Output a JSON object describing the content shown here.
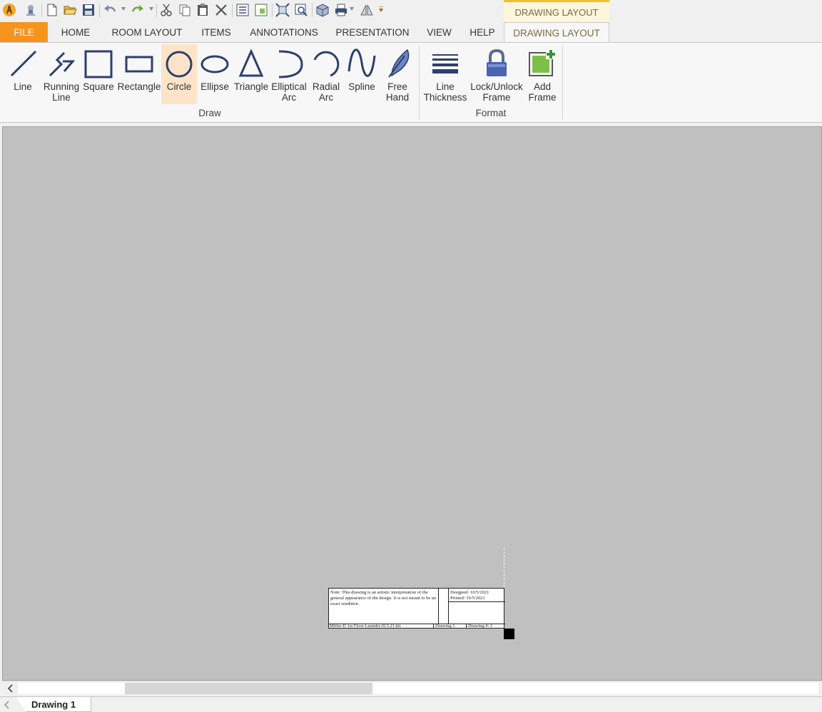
{
  "contextual_header": "DRAWING LAYOUT",
  "tabs": {
    "file": "FILE",
    "home": "HOME",
    "room_layout": "ROOM LAYOUT",
    "items": "ITEMS",
    "annotations": "ANNOTATIONS",
    "presentation": "PRESENTATION",
    "view": "VIEW",
    "help": "HELP",
    "drawing_layout": "DRAWING LAYOUT"
  },
  "ribbon": {
    "draw": {
      "label": "Draw",
      "buttons": {
        "line": "Line",
        "running_line": "Running\nLine",
        "square": "Square",
        "rectangle": "Rectangle",
        "circle": "Circle",
        "ellipse": "Ellipse",
        "triangle": "Triangle",
        "elliptical_arc": "Elliptical\nArc",
        "radial_arc": "Radial\nArc",
        "spline": "Spline",
        "free_hand": "Free\nHand"
      },
      "selected": "circle"
    },
    "format": {
      "label": "Format",
      "buttons": {
        "line_thickness": "Line\nThickness",
        "lock_unlock": "Lock/Unlock\nFrame",
        "add_frame": "Add\nFrame"
      }
    }
  },
  "title_block": {
    "note": "Note: This drawing is an artistic interpretation of the general appearance of the design. It is not meant to be an exact rendition.",
    "designed": "Designed: 10/5/2021",
    "printed": "Printed: 10/5/2021",
    "file": "Miller-D 1st Floor Laundry10.5.21.kit",
    "drawing": "Drawing 1",
    "drawing_number": "Drawing #: 1"
  },
  "sheet_tab": "Drawing 1",
  "colors": {
    "file_tab": "#f7941d",
    "accent_gold": "#f0c030",
    "icon_blue": "#2e3f6e",
    "canvas": "#c0c0c0",
    "selected_button": "#fde4c8"
  }
}
